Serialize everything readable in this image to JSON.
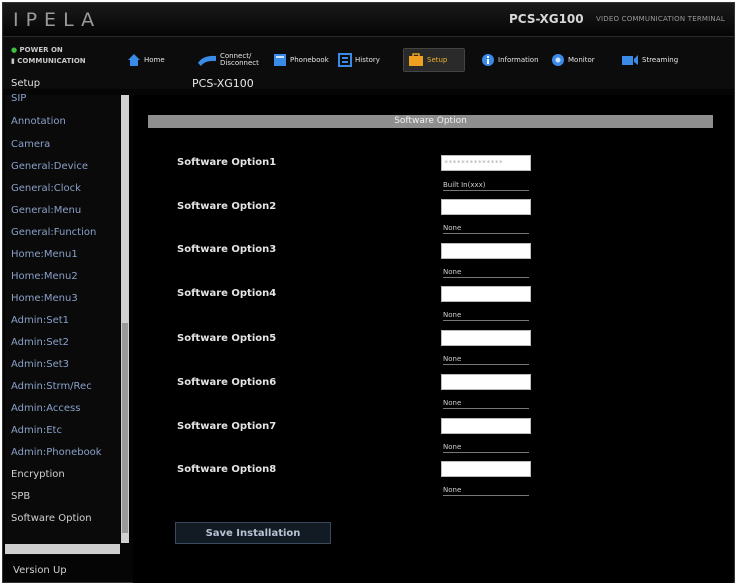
{
  "header": {
    "logo": "IPELA",
    "model": "PCS-XG100",
    "model_sub": "VIDEO COMMUNICATION TERMINAL"
  },
  "status": {
    "power": "POWER ON",
    "comm": "COMMUNICATION"
  },
  "nav": {
    "setup_label": "Setup",
    "model": "PCS-XG100",
    "tabs": [
      {
        "label": "Home",
        "icon": "home-icon"
      },
      {
        "label": "Connect/ Disconnect",
        "icon": "connect-icon"
      },
      {
        "label": "Phonebook",
        "icon": "phonebook-icon"
      },
      {
        "label": "History",
        "icon": "history-icon"
      },
      {
        "label": "Setup",
        "icon": "setup-icon",
        "active": true
      },
      {
        "label": "Information",
        "icon": "information-icon"
      },
      {
        "label": "Monitor",
        "icon": "monitor-icon"
      },
      {
        "label": "Streaming",
        "icon": "streaming-icon"
      }
    ]
  },
  "sidebar": {
    "items": [
      "SIP",
      "Annotation",
      "Camera",
      "General:Device",
      "General:Clock",
      "General:Menu",
      "General:Function",
      "Home:Menu1",
      "Home:Menu2",
      "Home:Menu3",
      "Admin:Set1",
      "Admin:Set2",
      "Admin:Set3",
      "Admin:Strm/Rec",
      "Admin:Access",
      "Admin:Etc",
      "Admin:Phonebook",
      "Encryption",
      "SPB",
      "Software Option"
    ],
    "version_label": "Version Up"
  },
  "content": {
    "section_title": "Software Option",
    "options": [
      {
        "label": "Software Option1",
        "value": "**************",
        "status": "Built In(xxx)"
      },
      {
        "label": "Software Option2",
        "value": "",
        "status": "None"
      },
      {
        "label": "Software Option3",
        "value": "",
        "status": "None"
      },
      {
        "label": "Software Option4",
        "value": "",
        "status": "None"
      },
      {
        "label": "Software Option5",
        "value": "",
        "status": "None"
      },
      {
        "label": "Software Option6",
        "value": "",
        "status": "None"
      },
      {
        "label": "Software Option7",
        "value": "",
        "status": "None"
      },
      {
        "label": "Software Option8",
        "value": "",
        "status": "None"
      }
    ],
    "save_label": "Save Installation"
  },
  "colors": {
    "accent": "#f0b030",
    "sidebar_text": "#8aa0c8",
    "section_bar": "#8e8e8e"
  }
}
